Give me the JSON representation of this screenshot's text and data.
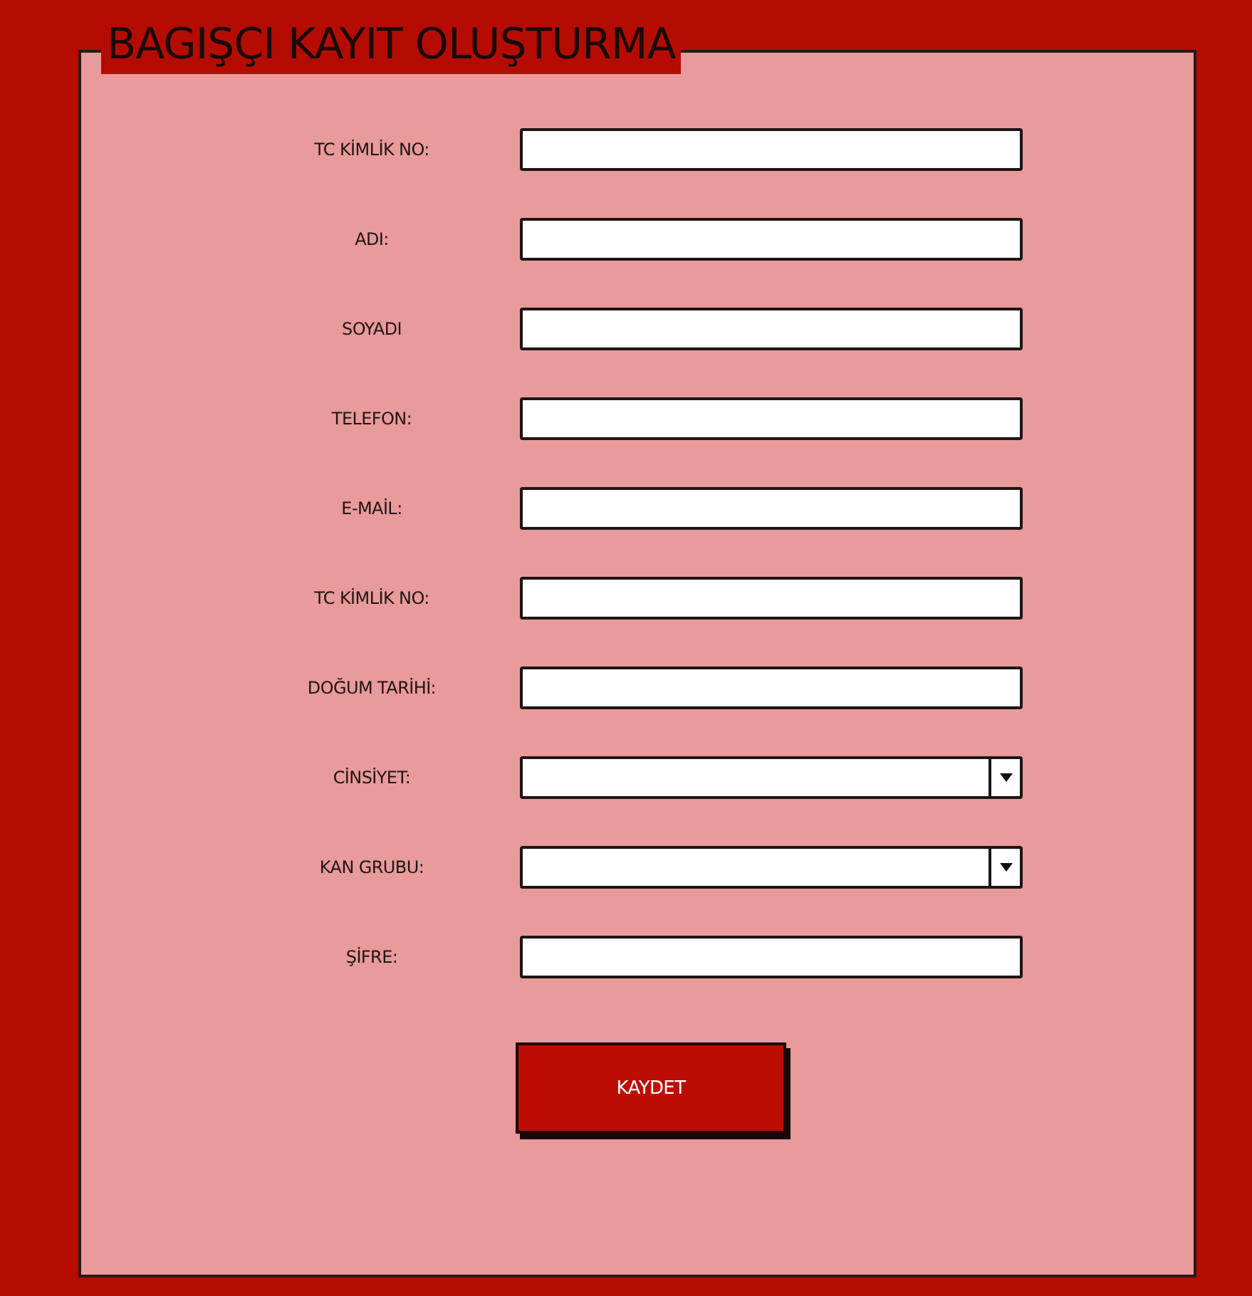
{
  "title": "BAGIŞÇI KAYIT OLUŞTURMA",
  "fields": [
    {
      "label": "TC KİMLİK NO:",
      "kind": "text"
    },
    {
      "label": "ADI:",
      "kind": "text"
    },
    {
      "label": "SOYADI",
      "kind": "text"
    },
    {
      "label": "TELEFON:",
      "kind": "text"
    },
    {
      "label": "E-MAİL:",
      "kind": "text"
    },
    {
      "label": "TC KİMLİK NO:",
      "kind": "text"
    },
    {
      "label": "DOĞUM TARİHİ:",
      "kind": "text"
    },
    {
      "label": "CİNSİYET:",
      "kind": "select"
    },
    {
      "label": "KAN GRUBU:",
      "kind": "select"
    },
    {
      "label": "ŞİFRE:",
      "kind": "text"
    }
  ],
  "button": "KAYDET"
}
